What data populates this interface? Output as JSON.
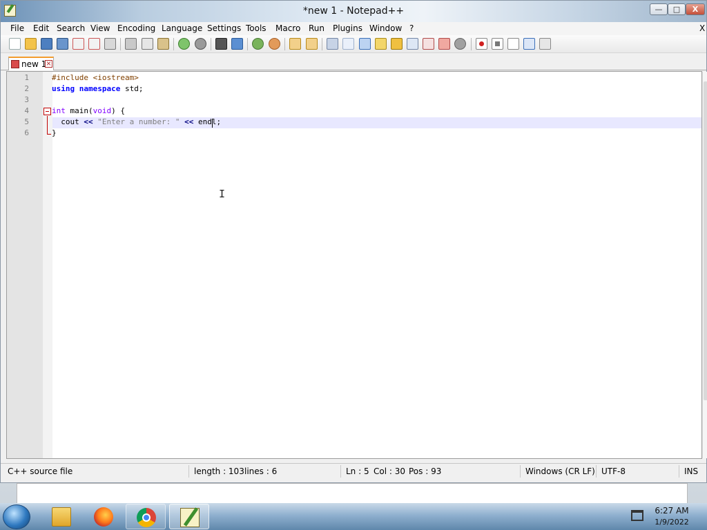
{
  "window": {
    "title": "*new 1 - Notepad++",
    "controls": {
      "minimize": "—",
      "maximize": "□",
      "close": "X"
    }
  },
  "menu": [
    "File",
    "Edit",
    "Search",
    "View",
    "Encoding",
    "Language",
    "Settings",
    "Tools",
    "Macro",
    "Run",
    "Plugins",
    "Window",
    "?"
  ],
  "menu_close": "X",
  "toolbar": {
    "icons": [
      "new-file",
      "open",
      "save",
      "save-all",
      "close",
      "close-all",
      "print",
      "cut",
      "copy",
      "paste",
      "undo",
      "redo",
      "find",
      "replace",
      "zoom-in",
      "zoom-out",
      "sync-vertical",
      "sync-horizontal",
      "word-wrap",
      "show-all-chars",
      "indent-guide",
      "user-language",
      "doc-map",
      "function-list",
      "folder-workspace",
      "monitoring",
      "record-macro",
      "stop-record",
      "play-macro",
      "run-macro-multiple",
      "save-macro"
    ]
  },
  "tabs": [
    {
      "label": "new 1",
      "active": true,
      "modified": true
    }
  ],
  "editor": {
    "line_numbers": [
      "1",
      "2",
      "3",
      "4",
      "5",
      "6"
    ],
    "current_line": 5,
    "lines": [
      {
        "pre": "#include <iostream>"
      },
      {
        "kw1": "using",
        "kw2": "namespace",
        "rest": " std;"
      },
      {
        "text": ""
      },
      {
        "type": "int",
        "rest1": " main(",
        "type2": "void",
        "rest2": ") {"
      },
      {
        "indent": "  ",
        "ident": "cout",
        "op1": " << ",
        "str": "\"Enter a number: \"",
        "op2": " << ",
        "rest": "endl;"
      },
      {
        "text": "}"
      }
    ]
  },
  "status": {
    "language": "C++ source file",
    "length": "length : 103",
    "lines": "lines : 6",
    "ln": "Ln : 5",
    "col": "Col : 30",
    "pos": "Pos : 93",
    "eol": "Windows (CR LF)",
    "encoding": "UTF-8",
    "mode": "INS"
  },
  "taskbar": {
    "apps": [
      "file-explorer",
      "firefox",
      "chrome",
      "notepad-plus-plus"
    ],
    "time": "6:27 AM",
    "date": "1/9/2022"
  },
  "colors": {
    "keyword": "#0000ff",
    "type": "#8000ff",
    "preprocessor": "#804000",
    "string": "#808080",
    "current_line": "#e8e8ff",
    "fold_marker": "#c00000"
  }
}
